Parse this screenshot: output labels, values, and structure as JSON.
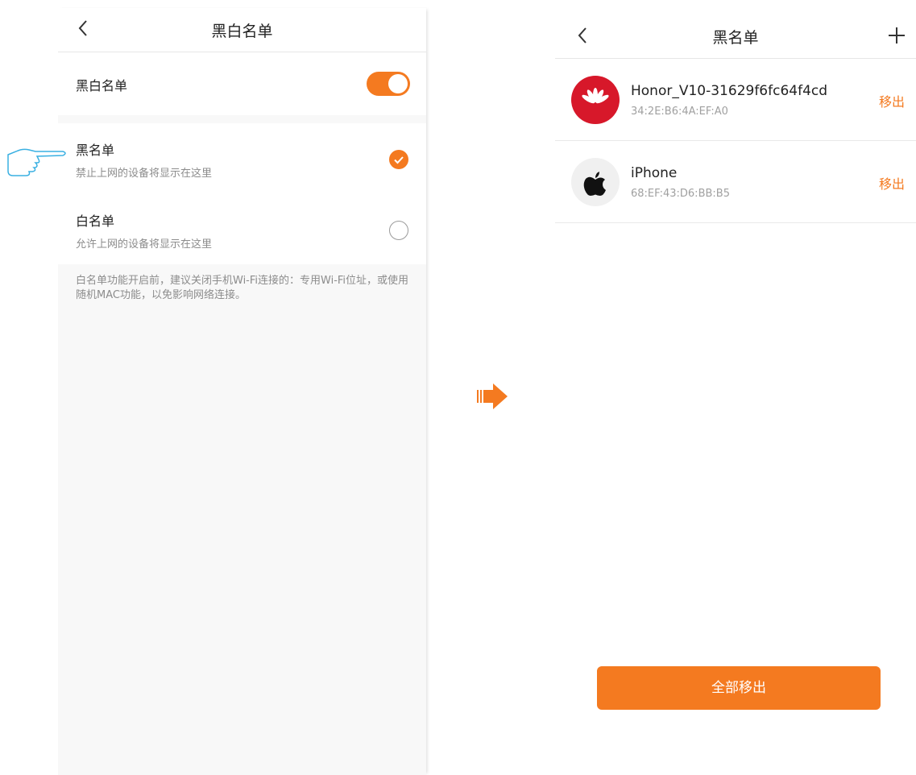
{
  "left": {
    "title": "黑白名单",
    "toggle_label": "黑白名单",
    "toggle_on": true,
    "options": [
      {
        "title": "黑名单",
        "desc": "禁止上网的设备将显示在这里",
        "selected": true
      },
      {
        "title": "白名单",
        "desc": "允许上网的设备将显示在这里",
        "selected": false
      }
    ],
    "note": "白名单功能开启前，建议关闭手机Wi-Fi连接的：专用Wi-Fi位址，或使用随机MAC功能，以免影响网络连接。"
  },
  "right": {
    "title": "黑名单",
    "devices": [
      {
        "name": "Honor_V10-31629f6fc64f4cd",
        "mac": "34:2E:B6:4A:EF:A0",
        "icon": "huawei-logo-icon",
        "remove_label": "移出"
      },
      {
        "name": "iPhone",
        "mac": "68:EF:43:D6:BB:B5",
        "icon": "apple-logo-icon",
        "remove_label": "移出"
      }
    ],
    "remove_all_label": "全部移出"
  },
  "colors": {
    "accent": "#f47a20",
    "huawei_red": "#d7182a",
    "hand_outline": "#3ab0e2"
  },
  "icons": [
    "back-chevron-icon",
    "plus-icon",
    "check-icon",
    "pointing-hand-icon",
    "right-arrow-icon"
  ]
}
